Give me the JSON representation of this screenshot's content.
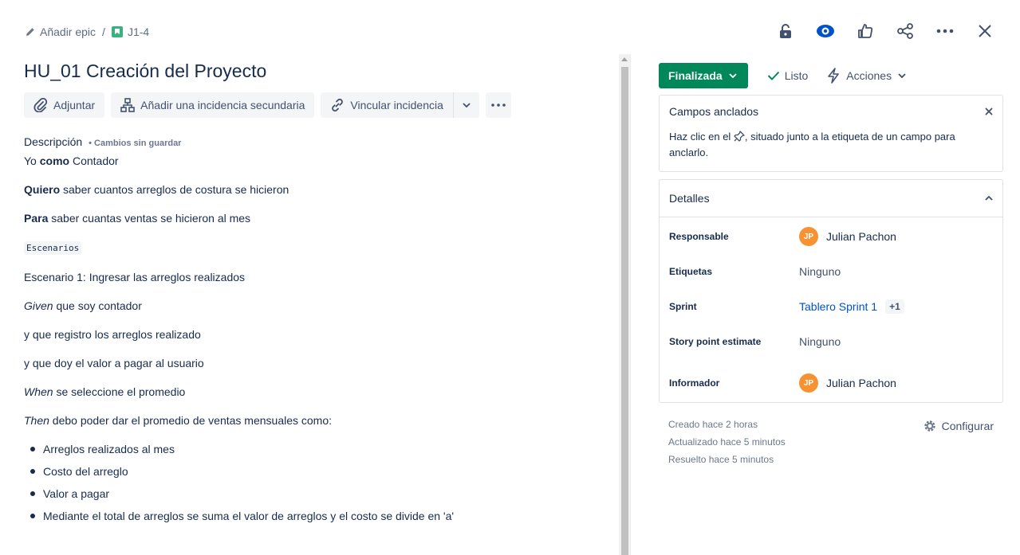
{
  "breadcrumb": {
    "epic_label": "Añadir epic",
    "separator": "/",
    "issue_key": "J1-4"
  },
  "issue": {
    "title": "HU_01 Creación del Proyecto"
  },
  "actions": {
    "attach": "Adjuntar",
    "add_child": "Añadir una incidencia secundaria",
    "link_issue": "Vincular incidencia"
  },
  "description": {
    "label": "Descripción",
    "unsaved": "• Cambios sin guardar",
    "line1_a": "Yo ",
    "line1_b": "como",
    "line1_c": " Contador",
    "line2_a": "Quiero",
    "line2_b": " saber cuantos arreglos de costura se hicieron",
    "line3_a": "Para",
    "line3_b": " saber cuantas ventas se hicieron al mes",
    "code": "Escenarios",
    "scenario": "Escenario 1: Ingresar las arreglos realizados",
    "given_a": "Given",
    "given_b": " que soy contador",
    "and1": "y que registro los arreglos realizado",
    "and2": "y que doy el valor a pagar al usuario",
    "when_a": "When",
    "when_b": " se seleccione el promedio",
    "then_a": "Then",
    "then_b": " debo poder dar el promedio de ventas mensuales como:",
    "bullets": [
      "Arreglos realizados al mes",
      "Costo del arreglo",
      "Valor a pagar",
      "Mediante el total de arreglos se suma  el valor de arreglos y el costo se divide en  'a'"
    ]
  },
  "status": {
    "button": "Finalizada",
    "resolution": "Listo",
    "actions": "Acciones"
  },
  "pinned": {
    "title": "Campos anclados",
    "text_before": "Haz clic en el ",
    "text_after": ", situado junto a la etiqueta de un campo para anclarlo."
  },
  "details": {
    "title": "Detalles",
    "fields": [
      {
        "label": "Responsable",
        "value": "Julian Pachon",
        "initials": "JP"
      },
      {
        "label": "Etiquetas",
        "value": "Ninguno"
      },
      {
        "label": "Sprint",
        "value": "Tablero Sprint 1",
        "extra": "+1"
      },
      {
        "label": "Story point estimate",
        "value": "Ninguno"
      },
      {
        "label": "Informador",
        "value": "Julian Pachon",
        "initials": "JP"
      }
    ]
  },
  "meta": {
    "created": "Creado hace 2 horas",
    "updated": "Actualizado hace 5 minutos",
    "resolved": "Resuelto hace 5 minutos",
    "configure": "Configurar"
  },
  "colors": {
    "status_green": "#00875a",
    "link_blue": "#0052cc",
    "avatar_orange": "#f79232",
    "watch_blue": "#0052cc"
  }
}
